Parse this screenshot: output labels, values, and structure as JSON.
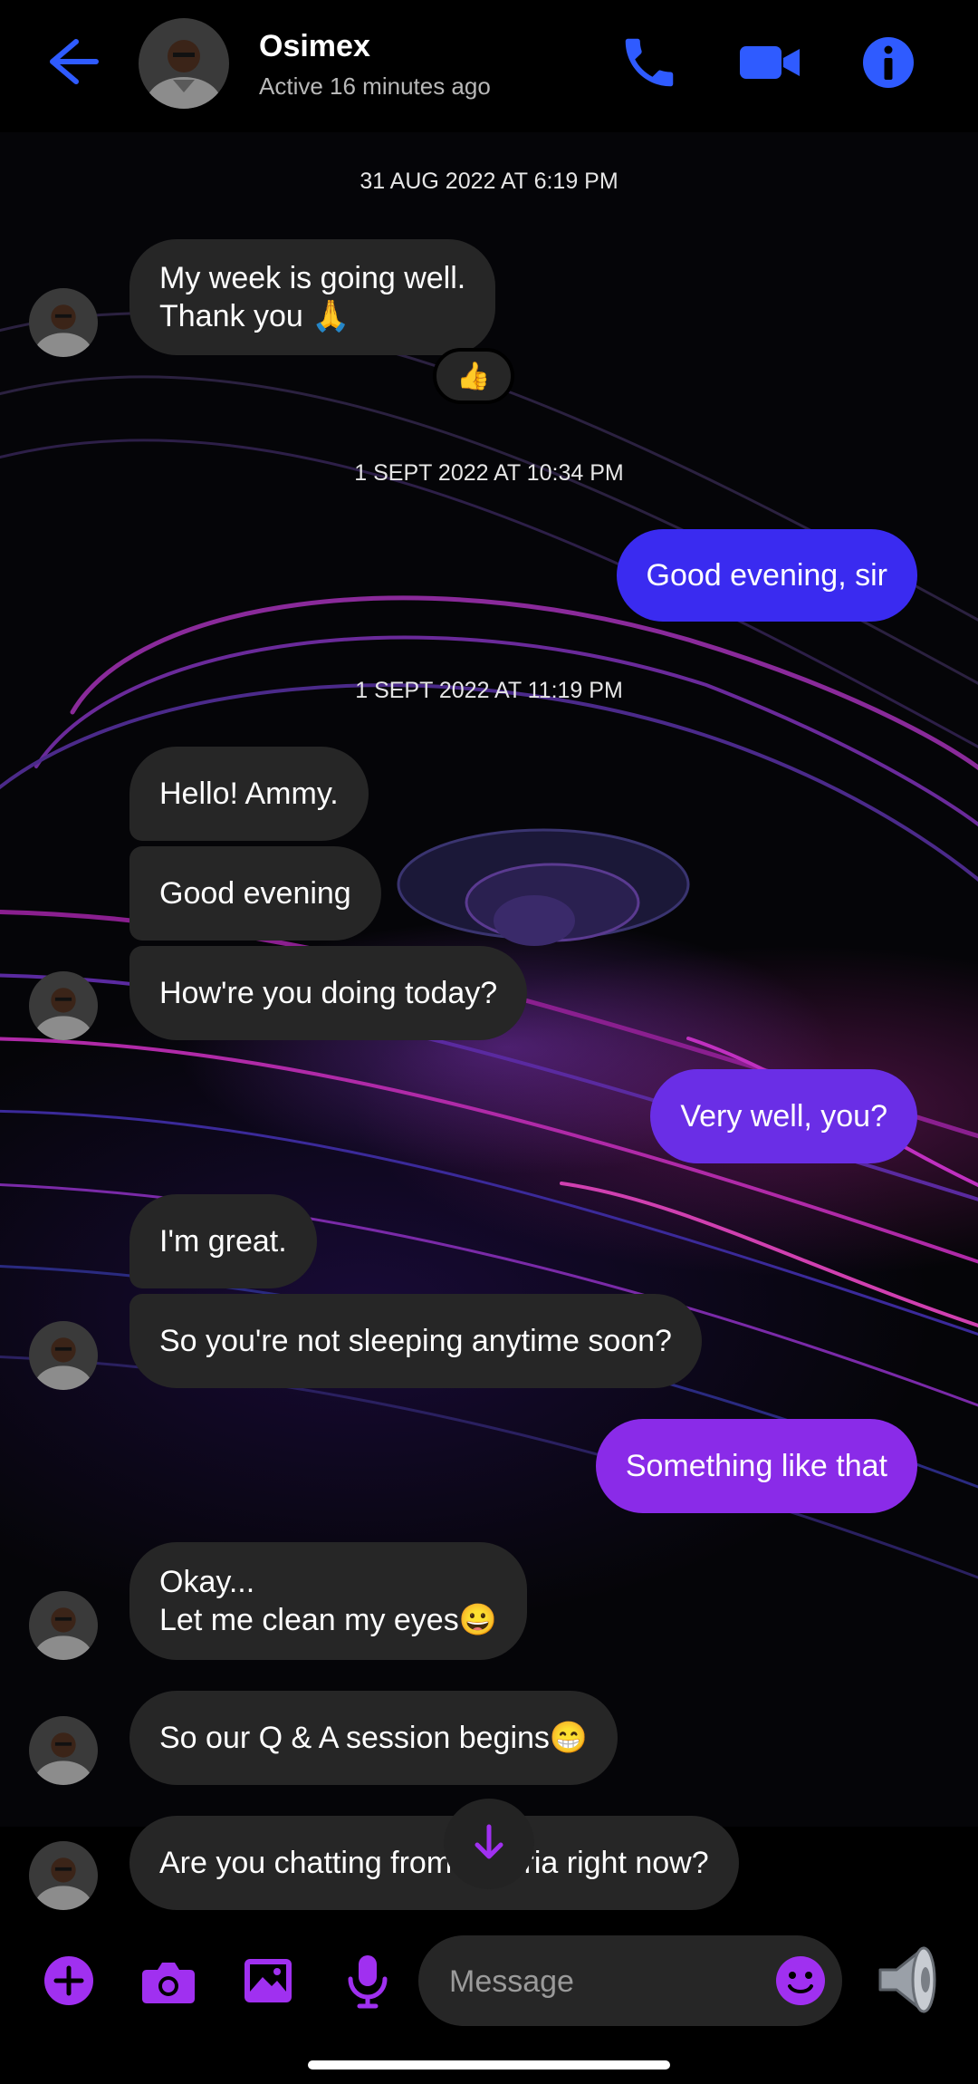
{
  "header": {
    "contact_name": "Osimex",
    "status": "Active 16 minutes ago",
    "icons": [
      "back-arrow-icon",
      "phone-icon",
      "video-camera-icon",
      "info-icon"
    ]
  },
  "colors": {
    "accent": "#2f5bff",
    "outgoing_start": "#3a2bf0",
    "outgoing_end": "#8a2be8",
    "incoming": "#262626",
    "composer_icon": "#a030f0"
  },
  "messages": [
    {
      "type": "timestamp",
      "text": "31 AUG 2022 AT 6:19 PM"
    },
    {
      "type": "incoming",
      "lines": [
        "My week is going well.",
        "Thank you 🙏"
      ],
      "reaction": "👍"
    },
    {
      "type": "timestamp",
      "text": "1 SEPT 2022 AT 10:34 PM"
    },
    {
      "type": "outgoing",
      "text": "Good evening, sir"
    },
    {
      "type": "timestamp",
      "text": "1 SEPT 2022 AT 11:19 PM"
    },
    {
      "type": "incoming",
      "text": "Hello! Ammy."
    },
    {
      "type": "incoming",
      "text": "Good evening"
    },
    {
      "type": "incoming",
      "text": "How're you doing today?"
    },
    {
      "type": "outgoing",
      "text": "Very well, you?"
    },
    {
      "type": "incoming",
      "text": "I'm great."
    },
    {
      "type": "incoming",
      "text": "So you're not sleeping anytime soon?"
    },
    {
      "type": "outgoing",
      "text": "Something like that"
    },
    {
      "type": "incoming",
      "lines": [
        "Okay...",
        "Let me clean my eyes😀"
      ]
    },
    {
      "type": "incoming",
      "text": "So our Q & A session begins😁"
    },
    {
      "type": "incoming",
      "text": "Are you chatting from Nigeria right now?"
    }
  ],
  "composer": {
    "placeholder": "Message",
    "icons": [
      "plus-icon",
      "camera-icon",
      "gallery-icon",
      "microphone-icon",
      "emoji-icon",
      "speaker-icon",
      "scroll-down-arrow-icon"
    ]
  }
}
